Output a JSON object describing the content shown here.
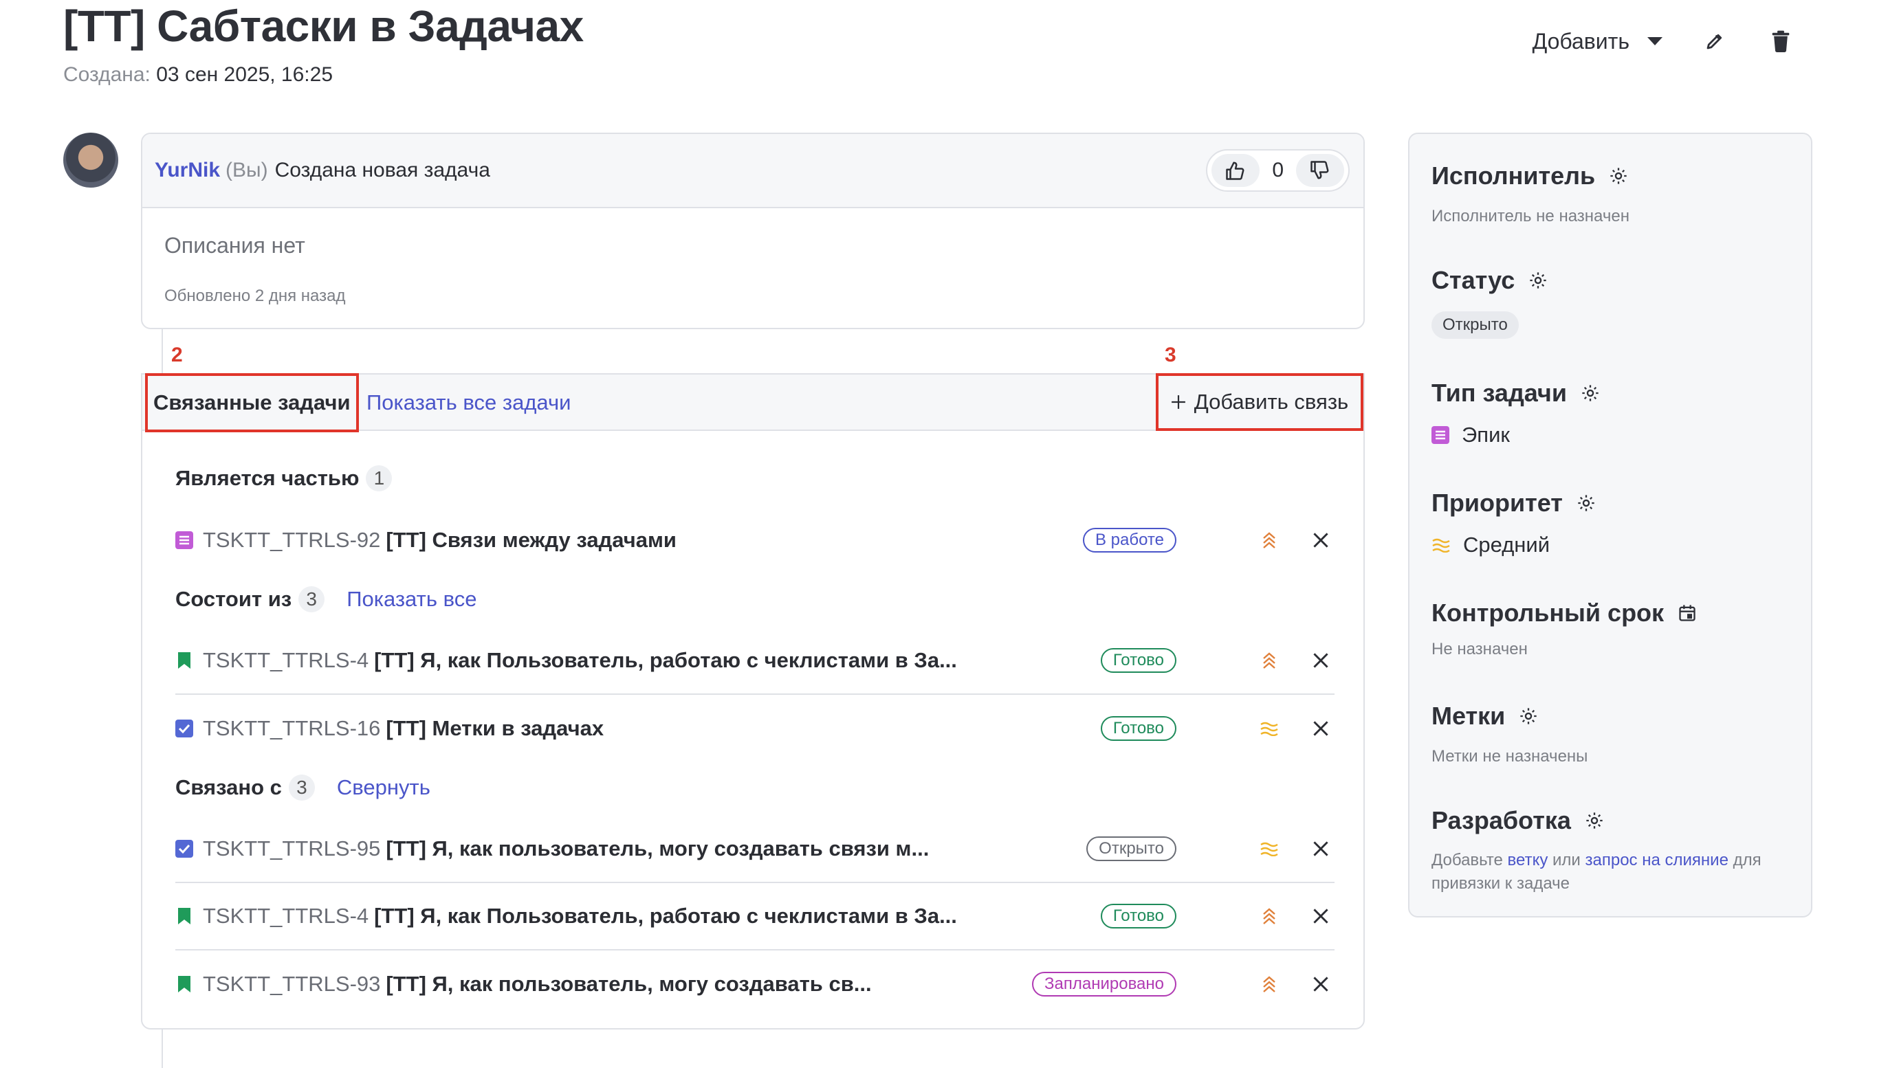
{
  "header": {
    "title": "[TT] Сабтаски в Задачах",
    "created_label": "Создана:",
    "created_value": "03 сен 2025, 16:25",
    "add_label": "Добавить"
  },
  "comment": {
    "user": "YurNik",
    "you": "(Вы)",
    "text": "Создана новая задача",
    "votes": "0",
    "description": "Описания нет",
    "updated": "Обновлено 2 дня назад"
  },
  "annotations": {
    "left_num": "2",
    "right_num": "3"
  },
  "links": {
    "tab_related": "Связанные задачи",
    "tab_all": "Показать все задачи",
    "add_link": "Добавить связь",
    "sections": [
      {
        "title": "Является частью",
        "count": "1",
        "link": ""
      },
      {
        "title": "Состоит из",
        "count": "3",
        "link": "Показать все"
      },
      {
        "title": "Связано с",
        "count": "3",
        "link": "Свернуть"
      }
    ],
    "rows": [
      {
        "key": "TSKTT_TTRLS-92",
        "title": "[TT] Связи между задачами",
        "status": "В работе",
        "type": "epic",
        "prio": "high"
      },
      {
        "key": "TSKTT_TTRLS-4",
        "title": "[TT] Я, как Пользователь, работаю с чеклистами в За...",
        "status": "Готово",
        "type": "story",
        "prio": "high"
      },
      {
        "key": "TSKTT_TTRLS-16",
        "title": "[TT] Метки в задачах",
        "status": "Готово",
        "type": "task",
        "prio": "medium"
      },
      {
        "key": "TSKTT_TTRLS-95",
        "title": "[TT] Я, как пользователь, могу создавать связи м...",
        "status": "Открыто",
        "type": "task",
        "prio": "medium"
      },
      {
        "key": "TSKTT_TTRLS-4",
        "title": "[TT] Я, как Пользователь, работаю с чеклистами в За...",
        "status": "Готово",
        "type": "story",
        "prio": "high"
      },
      {
        "key": "TSKTT_TTRLS-93",
        "title": "[TT] Я, как пользователь, могу создавать св...",
        "status": "Запланировано",
        "type": "story",
        "prio": "high"
      }
    ]
  },
  "sidebar": {
    "assignee_title": "Исполнитель",
    "assignee_value": "Исполнитель не назначен",
    "status_title": "Статус",
    "status_value": "Открыто",
    "type_title": "Тип задачи",
    "type_value": "Эпик",
    "priority_title": "Приоритет",
    "priority_value": "Средний",
    "due_title": "Контрольный срок",
    "due_value": "Не назначен",
    "labels_title": "Метки",
    "labels_value": "Метки не назначены",
    "dev_title": "Разработка",
    "dev_text_1": "Добавьте",
    "dev_link_1": "ветку",
    "dev_text_2": "или",
    "dev_link_2": "запрос на слияние",
    "dev_text_3": "для привязки к задаче"
  },
  "colors": {
    "accent": "#4a55c9",
    "annotation_red": "#e0352a",
    "epic": "#c15bd6",
    "story": "#1f9b5a",
    "task": "#5468d4",
    "prio_high": "#e0803a",
    "prio_medium": "#f0b429"
  }
}
